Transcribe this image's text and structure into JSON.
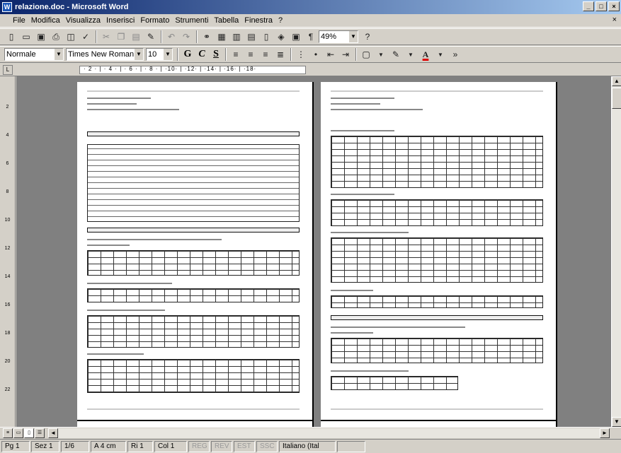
{
  "window": {
    "title": "relazione.doc - Microsoft Word",
    "app_icon": "word-icon",
    "controls": [
      "_",
      "□",
      "×"
    ]
  },
  "menu": {
    "items": [
      "File",
      "Modifica",
      "Visualizza",
      "Inserisci",
      "Formato",
      "Strumenti",
      "Tabella",
      "Finestra",
      "?"
    ],
    "close_glyph": "×"
  },
  "standard_toolbar": {
    "zoom": "49%"
  },
  "formatting_toolbar": {
    "style": "Normale",
    "font": "Times New Roman",
    "size": "10",
    "bold": "G",
    "italic": "C",
    "underline": "S"
  },
  "ruler": {
    "ticks": "· 2 · | · 4 · | · 6 · | · 8 · | ·10· | ·12· | ·14· | ·16· | ·18·"
  },
  "statusbar": {
    "page": "Pg 1",
    "section": "Sez 1",
    "page_of": "1/6",
    "at": "A 4 cm",
    "line": "Ri 1",
    "col": "Col 1",
    "rec": "REG",
    "trk": "REV",
    "ext": "EST",
    "ovr": "SSC",
    "language": "Italiano (Ital"
  }
}
